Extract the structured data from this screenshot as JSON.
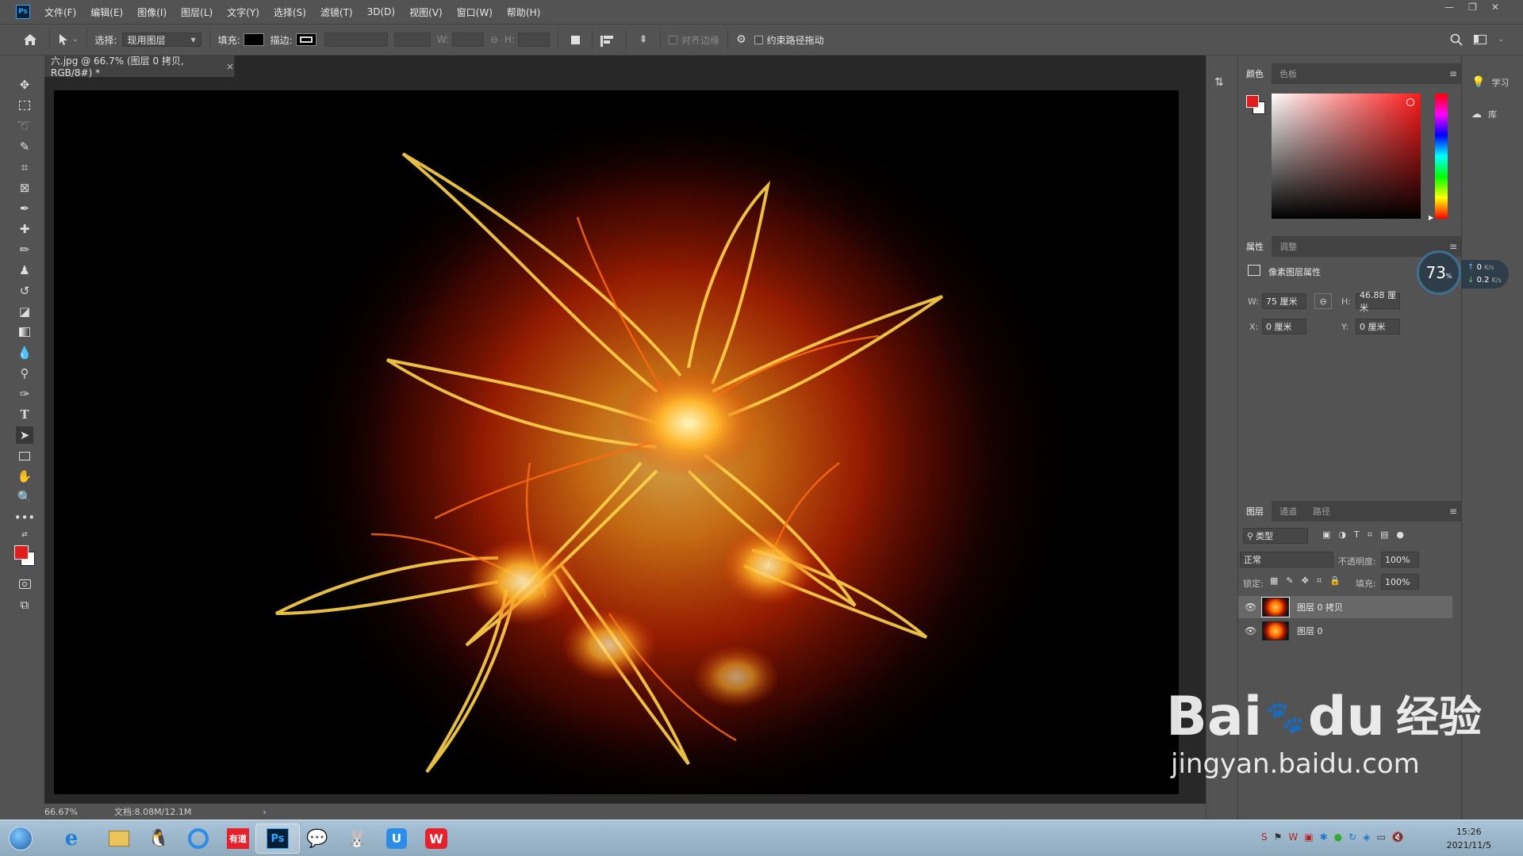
{
  "app": {
    "logo": "Ps"
  },
  "menu": [
    "文件(F)",
    "编辑(E)",
    "图像(I)",
    "图层(L)",
    "文字(Y)",
    "选择(S)",
    "滤镜(T)",
    "3D(D)",
    "视图(V)",
    "窗口(W)",
    "帮助(H)"
  ],
  "window_controls": {
    "minimize": "—",
    "restore": "❐",
    "close": "✕"
  },
  "options": {
    "select_label": "选择:",
    "select_value": "现用图层",
    "fill_label": "填充:",
    "stroke_label": "描边:",
    "w_label": "W:",
    "h_label": "H:",
    "align_edges_label": "对齐边缘",
    "constrain_label": "约束路径拖动"
  },
  "document": {
    "tab_title": "六.jpg @ 66.7% (图层 0 拷贝, RGB/8#) *",
    "tab_close": "×",
    "zoom": "66.67%",
    "doc_info": "文档:8.08M/12.1M",
    "status_arrow": "›"
  },
  "color_panel": {
    "tabs": [
      "颜色",
      "色板"
    ],
    "foreground": "#e01c1c",
    "background": "#ffffff",
    "hue": "#ff1a1a"
  },
  "properties_panel": {
    "tabs": [
      "属性",
      "调整"
    ],
    "title": "像素图层属性",
    "w_label": "W:",
    "w_value": "75 厘米",
    "h_label": "H:",
    "h_value": "46.88 厘米",
    "x_label": "X:",
    "x_value": "0 厘米",
    "y_label": "Y:",
    "y_value": "0 厘米"
  },
  "layers_panel": {
    "tabs": [
      "图层",
      "通道",
      "路径"
    ],
    "filter_label": "类型",
    "blend_mode": "正常",
    "opacity_label": "不透明度:",
    "opacity_value": "100%",
    "lock_label": "锁定:",
    "fill_label": "填充:",
    "fill_value": "100%",
    "layers": [
      {
        "name": "图层 0 拷贝",
        "selected": true
      },
      {
        "name": "图层 0",
        "selected": false
      }
    ]
  },
  "learn_panel": {
    "learn_label": "学习",
    "library_label": "库"
  },
  "net_widget": {
    "percent": "73",
    "percent_unit": "%",
    "up": "0",
    "up_unit": "K/s",
    "down": "0.2",
    "down_unit": "K/s"
  },
  "taskbar": {
    "youdao_label": "有道",
    "ps_label": "Ps",
    "time": "15:26",
    "date": "2021/11/5"
  },
  "watermark": {
    "brand": "Bai",
    "brand2": "du",
    "cn": "经验",
    "url": "jingyan.baidu.com"
  },
  "colors": {
    "accent": "#31a8ff",
    "ui_bg": "#535353",
    "canvas_bg": "#000000"
  }
}
